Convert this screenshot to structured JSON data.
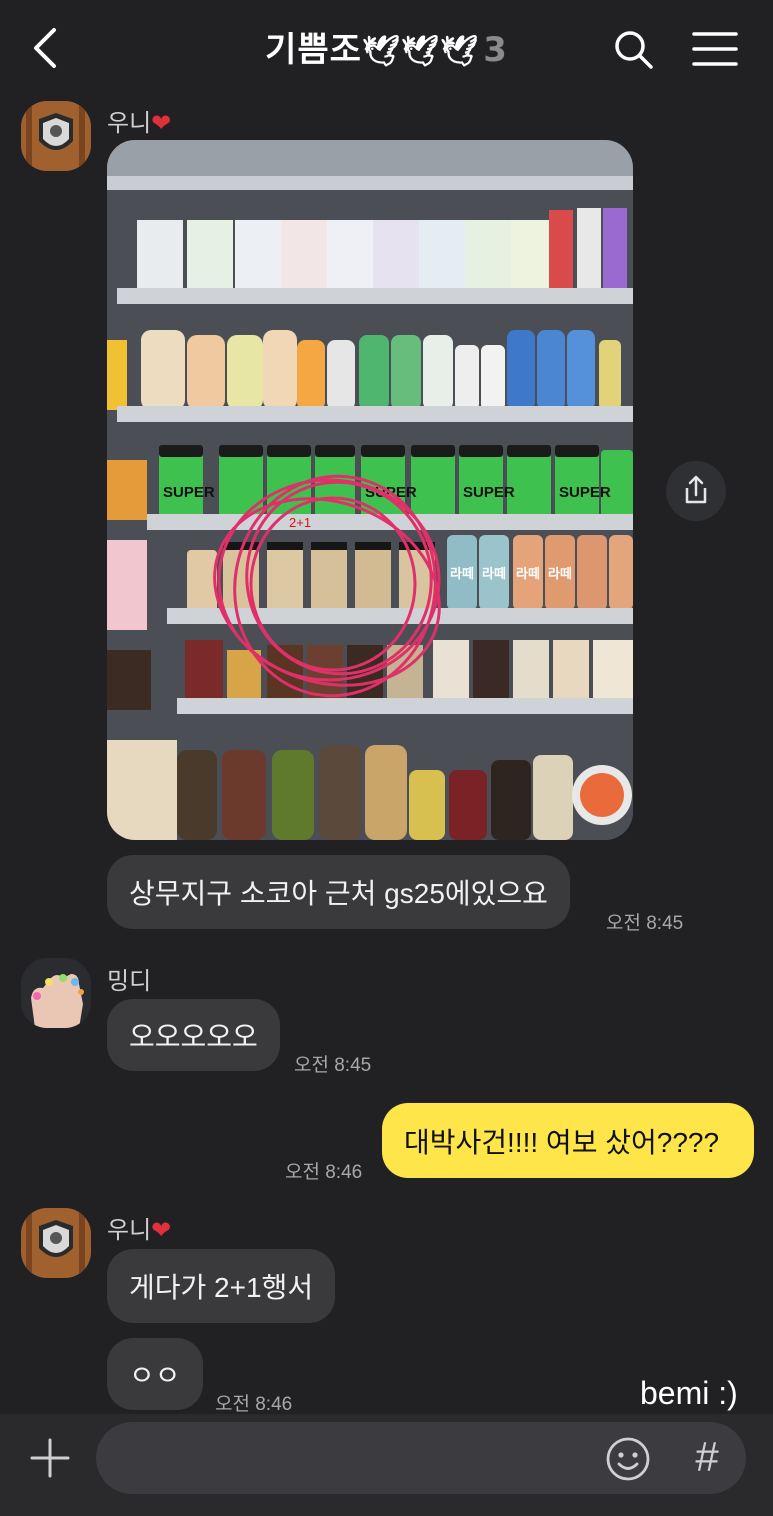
{
  "header": {
    "title": "기쁨조",
    "doves": [
      "🕊",
      "🕊",
      "🕊"
    ],
    "member_count": "3"
  },
  "messages": [
    {
      "sender": "우니",
      "heart": "❤",
      "type": "photo"
    },
    {
      "sender": "우니",
      "type": "text",
      "text": "상무지구 소코아 근처 gs25에있으요",
      "time": "오전 8:45"
    },
    {
      "sender": "밍디",
      "type": "text",
      "text": "오오오오오",
      "time": "오전 8:45"
    },
    {
      "sender": "me",
      "type": "text",
      "text": "대박사건!!!! 여보 샀어????",
      "time": "오전 8:46"
    },
    {
      "sender": "우니",
      "heart": "❤",
      "type": "text",
      "text": "게다가 2+1행서"
    },
    {
      "sender": "우니",
      "type": "text",
      "text": "ㅇㅇ",
      "time": "오전 8:46"
    }
  ],
  "photo": {
    "shelf_labels": [
      "SUPER",
      "라떼",
      "2+1"
    ]
  },
  "watermark": "bemi :)",
  "composer": {
    "placeholder": ""
  },
  "icons": [
    "back-icon",
    "search-icon",
    "menu-icon",
    "share-icon",
    "plus-icon",
    "emoji-icon",
    "hash-icon"
  ],
  "colors": {
    "background": "#212124",
    "my_bubble": "#fde54a",
    "other_bubble": "#3a3a3d",
    "circle_mark": "#e0306a"
  }
}
